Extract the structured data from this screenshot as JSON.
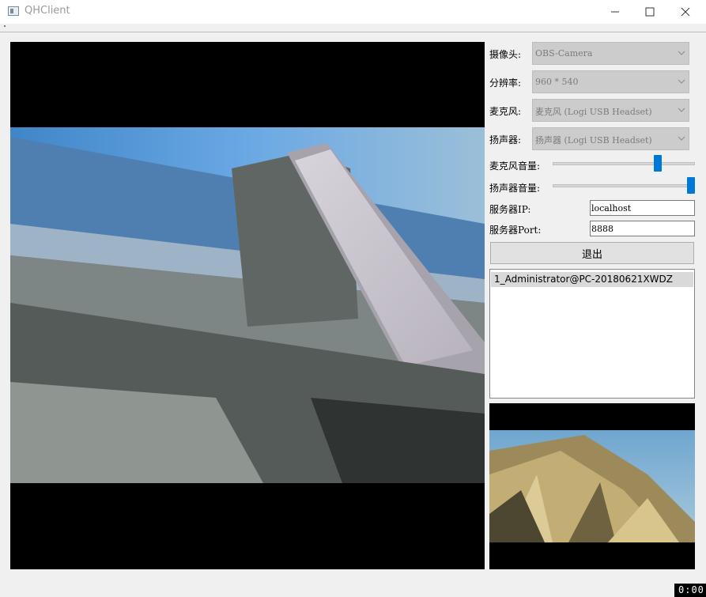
{
  "window": {
    "title": "QHClient"
  },
  "settings": {
    "camera_label": "摄像头:",
    "camera_value": "OBS-Camera",
    "resolution_label": "分辨率:",
    "resolution_value": "960 * 540",
    "mic_label": "麦克风:",
    "mic_value": "麦克风 (Logi USB Headset)",
    "speaker_label": "扬声器:",
    "speaker_value": "扬声器 (Logi USB Headset)",
    "mic_volume_label": "麦克风音量:",
    "mic_volume_level": 0.75,
    "speaker_volume_label": "扬声器音量:",
    "speaker_volume_level": 1.0,
    "server_ip_label": "服务器IP:",
    "server_ip_value": "localhost",
    "server_port_label": "服务器Port:",
    "server_port_value": "8888",
    "exit_label": "退出"
  },
  "users": [
    "1_Administrator@PC-20180621XWDZ"
  ],
  "overlay": {
    "time": "0:00"
  },
  "icons": {
    "app": "app-window-icon",
    "minimize": "minimize-icon",
    "maximize": "maximize-icon",
    "close": "close-icon",
    "dropdown": "chevron-down-icon"
  }
}
